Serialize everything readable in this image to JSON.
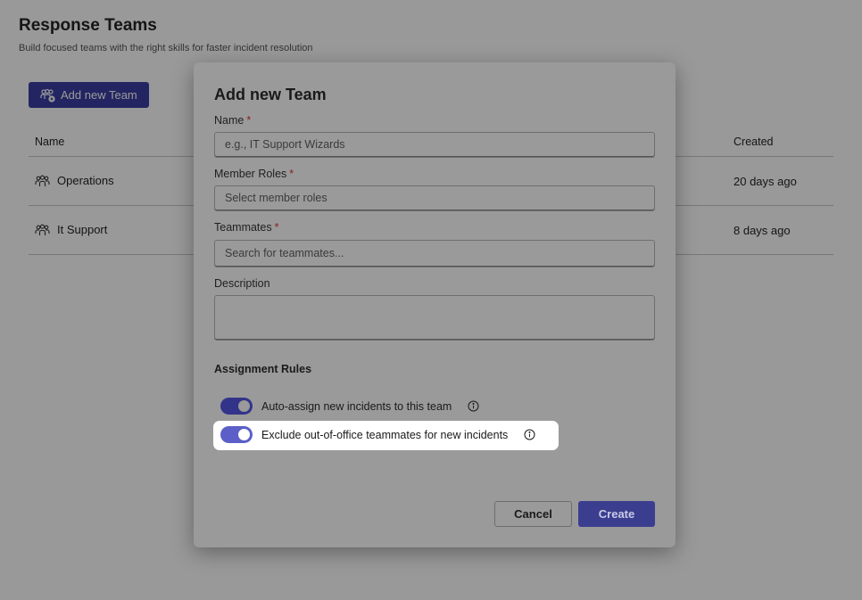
{
  "page": {
    "title": "Response Teams",
    "subtitle": "Build focused teams with the right skills for faster incident resolution",
    "add_button_label": "Add new Team",
    "table": {
      "columns": {
        "name": "Name",
        "created": "Created"
      },
      "rows": [
        {
          "name": "Operations",
          "created": "20 days ago",
          "icon": "people-team-icon"
        },
        {
          "name": "It Support",
          "created": "8 days ago",
          "icon": "people-team-icon"
        }
      ]
    }
  },
  "modal": {
    "title": "Add new Team",
    "required_mark": "*",
    "fields": {
      "name": {
        "label": "Name",
        "placeholder": "e.g., IT Support Wizards"
      },
      "member_roles": {
        "label": "Member Roles",
        "placeholder": "Select member roles"
      },
      "teammates": {
        "label": "Teammates",
        "placeholder": "Search for teammates..."
      },
      "description": {
        "label": "Description",
        "value": ""
      }
    },
    "assignment_rules": {
      "title": "Assignment Rules",
      "auto_assign": {
        "label": "Auto-assign new incidents to this team",
        "enabled": true
      },
      "exclude_ooo": {
        "label": "Exclude out-of-office teammates for new incidents",
        "enabled": true
      }
    },
    "buttons": {
      "cancel": "Cancel",
      "create": "Create"
    }
  },
  "colors": {
    "brand": "#3b3ea3",
    "toggle_on": "#5b5fc7",
    "overlay": "rgba(0,0,0,0.40)"
  }
}
